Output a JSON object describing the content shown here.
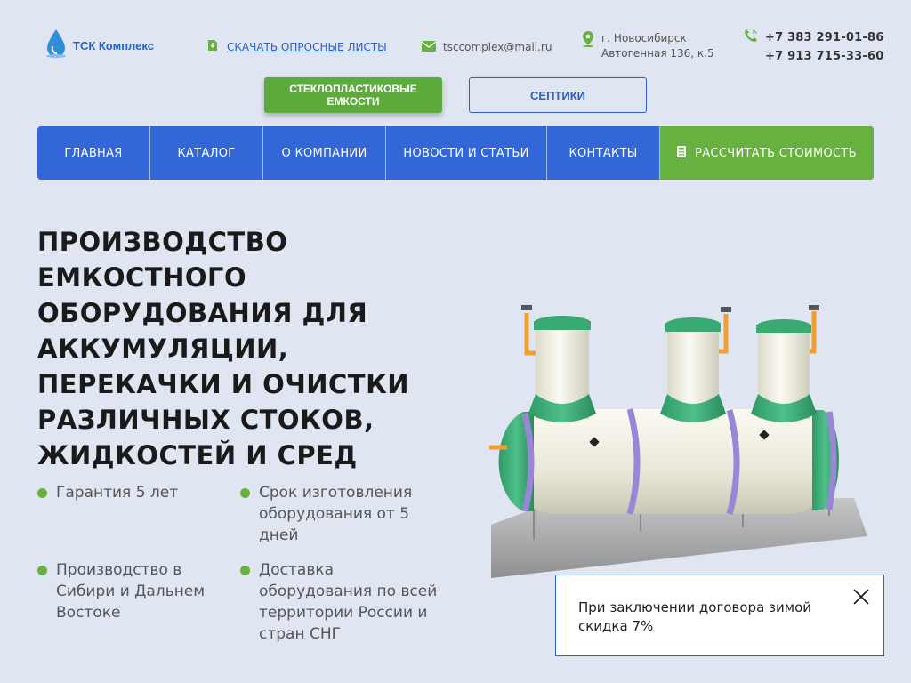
{
  "header": {
    "logo_text": "ТСК Комплекс",
    "download_link": "СКАЧАТЬ ОПРОСНЫЕ ЛИСТЫ",
    "email": "tsccomplex@mail.ru",
    "city": "г. Новосибирск",
    "street": "Автогенная 136, к.5",
    "phone_1": "+7 383 291-01-86",
    "phone_2": "+7 913 715-33-60"
  },
  "categories": {
    "glass_label": "СТЕКЛОПЛАСТИКОВЫЕ ЕМКОСТИ",
    "septic_label": "СЕПТИКИ"
  },
  "nav": {
    "items": [
      "ГЛАВНАЯ",
      "КАТАЛОГ",
      "О КОМПАНИИ",
      "НОВОСТИ И СТАТЬИ",
      "КОНТАКТЫ"
    ],
    "cta": "РАССЧИТАТЬ СТОИМОСТЬ"
  },
  "hero": {
    "title": "ПРОИЗВОДСТВО ЕМКОСТНОГО ОБОРУДОВАНИЯ ДЛЯ АККУМУЛЯЦИИ, ПЕРЕКАЧКИ И ОЧИСТКИ РАЗЛИЧНЫХ СТОКОВ, ЖИДКОСТЕЙ И СРЕД",
    "features": [
      "Гарантия 5 лет",
      "Срок изготовления оборудования от 5 дней",
      "Производство в Сибири и Дальнем Востоке",
      "Доставка оборудования по всей территории России и стран СНГ"
    ]
  },
  "notice": {
    "text": "При заключении договора зимой скидка 7%"
  },
  "colors": {
    "brand_blue": "#3366d6",
    "accent_green": "#66b13f",
    "background": "#dfe5f1"
  },
  "icons": {
    "logo": "water-drop-icon",
    "download": "document-icon",
    "email": "envelope-icon",
    "address": "map-pin-icon",
    "phone": "phone-icon",
    "calculator": "calculator-icon",
    "close": "close-icon"
  }
}
